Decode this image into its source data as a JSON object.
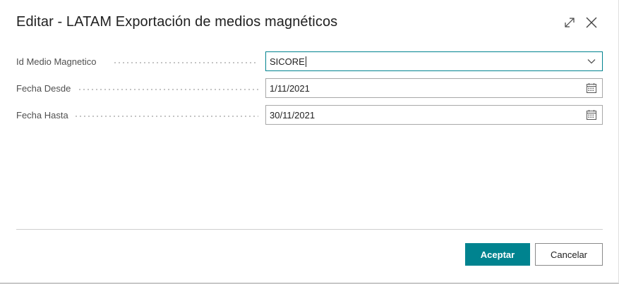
{
  "dialog": {
    "title": "Editar - LATAM Exportación de medios magnéticos",
    "expand_icon": "expand-icon",
    "close_icon": "close-icon"
  },
  "fields": [
    {
      "label": "Id Medio Magnetico",
      "value": "SICORE",
      "control": "dropdown",
      "icon": "chevron-down-icon"
    },
    {
      "label": "Fecha Desde",
      "value": "1/11/2021",
      "control": "date",
      "icon": "calendar-icon"
    },
    {
      "label": "Fecha Hasta",
      "value": "30/11/2021",
      "control": "date",
      "icon": "calendar-icon"
    }
  ],
  "footer": {
    "ok_label": "Aceptar",
    "cancel_label": "Cancelar"
  },
  "colors": {
    "accent": "#00838f",
    "border": "#a8a8a8",
    "text": "#212121",
    "label": "#505050"
  }
}
